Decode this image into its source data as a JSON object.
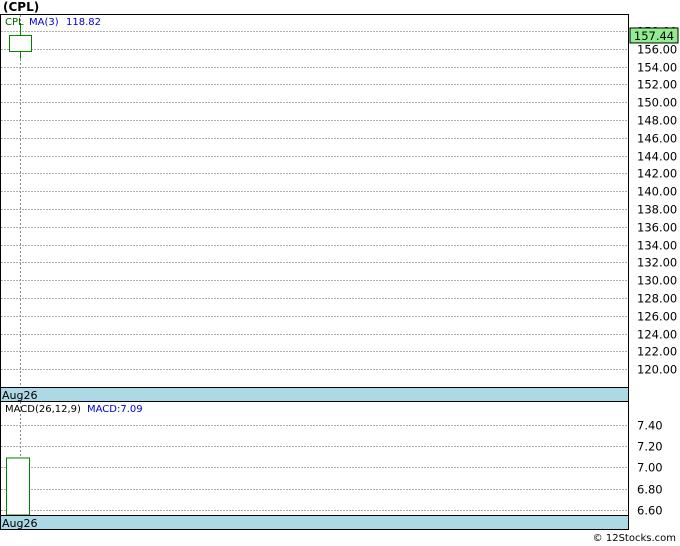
{
  "page": {
    "title": "(CPL)",
    "credit": "© 12Stocks.com"
  },
  "chart_data": [
    {
      "type": "candlestick",
      "symbol": "CPL",
      "x": [
        "Aug26"
      ],
      "ohlc": [
        {
          "open": 155.7,
          "high": 158.9,
          "low": 154.9,
          "close": 157.5
        }
      ],
      "last_price_label": "157.44",
      "ylim": [
        118.0,
        159.8
      ],
      "yticks": [
        120,
        122,
        124,
        126,
        128,
        130,
        132,
        134,
        136,
        138,
        140,
        142,
        144,
        146,
        148,
        150,
        152,
        154,
        156,
        158
      ],
      "ytick_labels": [
        "120.00",
        "122.00",
        "124.00",
        "126.00",
        "128.00",
        "130.00",
        "132.00",
        "134.00",
        "136.00",
        "138.00",
        "140.00",
        "142.00",
        "144.00",
        "146.00",
        "148.00",
        "150.00",
        "152.00",
        "154.00",
        "156.00",
        "158.00"
      ],
      "legend": {
        "symbol_label": "CPL",
        "ma_label": "MA(3)",
        "ma_value": "118.82"
      },
      "date_label": "Aug26",
      "grid": true,
      "colors": {
        "candle_border": "#008000",
        "symbol_text": "#006400",
        "ma_text": "#0000cc",
        "price_tag_bg": "#90ee90",
        "date_bar_bg": "#add8e6"
      }
    },
    {
      "type": "bar",
      "indicator": "MACD(26,12,9)",
      "x": [
        "Aug26"
      ],
      "values": [
        7.09
      ],
      "baseline": 6.55,
      "ylim": [
        6.55,
        7.62
      ],
      "yticks": [
        6.6,
        6.8,
        7.0,
        7.2,
        7.4
      ],
      "ytick_labels": [
        "6.60",
        "6.80",
        "7.00",
        "7.20",
        "7.40"
      ],
      "legend": {
        "indicator_label": "MACD(26,12,9)",
        "macd_label": "MACD:7.09"
      },
      "date_label": "Aug26",
      "grid": true,
      "colors": {
        "bar_border": "#008000",
        "macd_text": "#0000cc",
        "date_bar_bg": "#add8e6"
      }
    }
  ]
}
